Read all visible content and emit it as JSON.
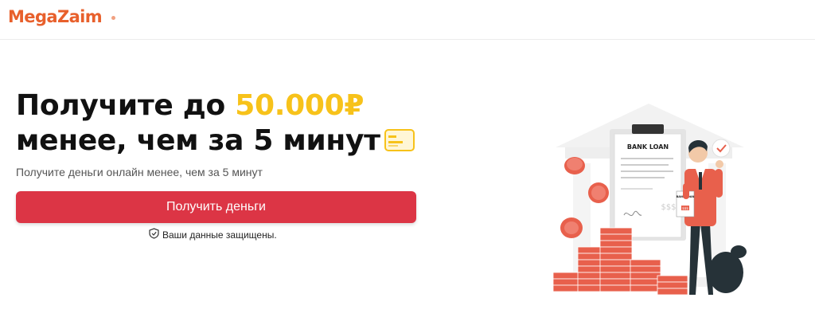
{
  "header": {
    "logo_text": "MegaZaim"
  },
  "hero": {
    "title_line1_prefix": "Получите до ",
    "title_amount": "50.000₽",
    "title_line2": "менее, чем за 5 минут",
    "subtitle": "Получите деньги онлайн менее, чем за 5 минут",
    "cta_label": "Получить деньги",
    "secure_note": "Ваши данные защищены."
  },
  "illustration": {
    "document_title": "BANK LOAN",
    "document_amount": "$$$",
    "small_doc_title": "BANK LOAN",
    "small_doc_amount": "$$$"
  },
  "colors": {
    "brand": "#e8602c",
    "accent": "#f7c21a",
    "cta": "#dc3545",
    "coin": "#e8604c"
  },
  "icons": {
    "card": "credit-card-icon",
    "shield": "shield-check-icon",
    "check": "check-badge-icon"
  }
}
